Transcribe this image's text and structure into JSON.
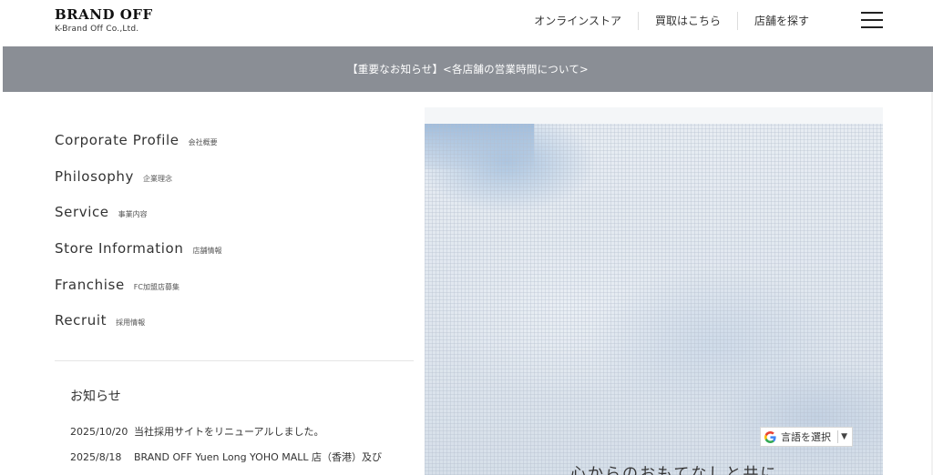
{
  "header": {
    "logo_main": "BRAND OFF",
    "logo_sub": "K-Brand Off Co.,Ltd.",
    "nav": [
      "オンラインストア",
      "買取はこちら",
      "店舗を探す"
    ]
  },
  "notice": {
    "text": "【重要なお知らせ】<各店舗の営業時間について>"
  },
  "menu": [
    {
      "en": "Corporate Profile",
      "ja": "会社概要"
    },
    {
      "en": "Philosophy",
      "ja": "企業理念"
    },
    {
      "en": "Service",
      "ja": "事業内容"
    },
    {
      "en": "Store Information",
      "ja": "店舗情報"
    },
    {
      "en": "Franchise",
      "ja": "FC加盟店募集"
    },
    {
      "en": "Recruit",
      "ja": "採用情報"
    }
  ],
  "news": {
    "title": "お知らせ",
    "items": [
      {
        "date": "2025/10/20",
        "text": "当社採用サイトをリニューアルしました。"
      },
      {
        "date": "2025/8/18",
        "text": "BRAND OFF Yuen Long YOHO MALL 店（香港）及び"
      }
    ]
  },
  "hero": {
    "caption": "心からのおもてなしと共に"
  },
  "lang_widget": {
    "label": "言語を選択",
    "arrow": "▼"
  },
  "colors": {
    "notice_bar": "#8a8e95",
    "google_blue": "#4285F4",
    "google_red": "#EA4335",
    "google_yellow": "#FBBC05",
    "google_green": "#34A853"
  }
}
